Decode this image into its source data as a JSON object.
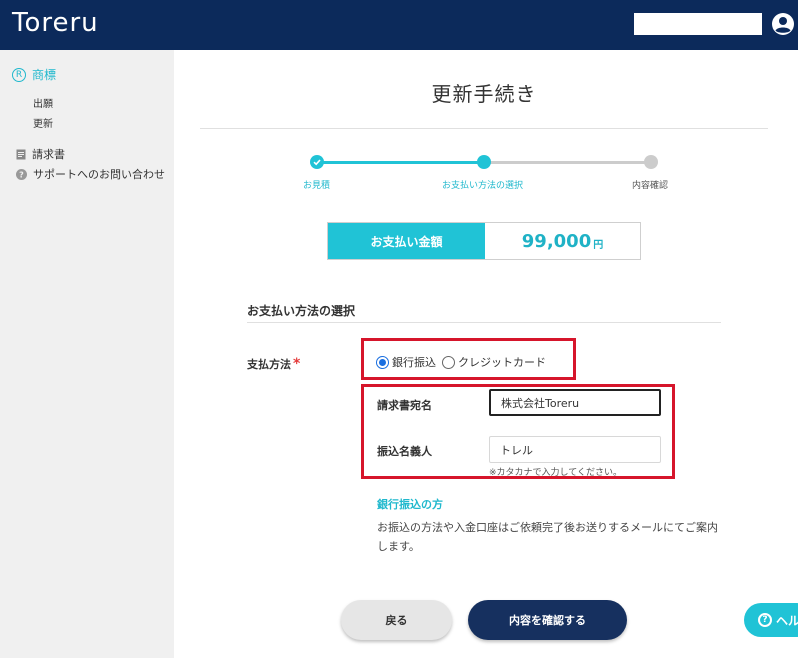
{
  "header": {
    "logo": "Toreru",
    "search_value": ""
  },
  "sidebar": {
    "trademark_label": "商標",
    "trademark_icon": "registered-icon",
    "sub_items": [
      {
        "label": "出願"
      },
      {
        "label": "更新"
      }
    ],
    "items": [
      {
        "label": "請求書",
        "icon": "invoice-icon"
      },
      {
        "label": "サポートへのお問い合わせ",
        "icon": "help-circle-icon"
      }
    ]
  },
  "main": {
    "title": "更新手続き",
    "steps": [
      {
        "label": "お見積",
        "state": "done"
      },
      {
        "label": "お支払い方法の選択",
        "state": "current"
      },
      {
        "label": "内容確認",
        "state": "todo"
      }
    ],
    "amount": {
      "label": "お支払い金額",
      "value": "99,000",
      "unit": "円"
    },
    "section_title": "お支払い方法の選択",
    "payment_method": {
      "label": "支払方法",
      "required_mark": "*",
      "options": [
        {
          "label": "銀行振込",
          "checked": true
        },
        {
          "label": "クレジットカード",
          "checked": false
        }
      ]
    },
    "invoice_name": {
      "label": "請求書宛名",
      "value": "株式会社Toreru"
    },
    "transfer_name": {
      "label": "振込名義人",
      "value": "トレル",
      "hint": "※カタカナで入力してください。"
    },
    "bank_note": {
      "title": "銀行振込の方",
      "text": "お振込の方法や入金口座はご依頼完了後お送りするメールにてご案内します。"
    },
    "buttons": {
      "back": "戻る",
      "confirm": "内容を確認する"
    },
    "help_button": "ヘル"
  },
  "colors": {
    "header_bg": "#0c2a5b",
    "accent": "#20c3d6",
    "highlight_border": "#d6152b",
    "confirm_button": "#16305f"
  }
}
